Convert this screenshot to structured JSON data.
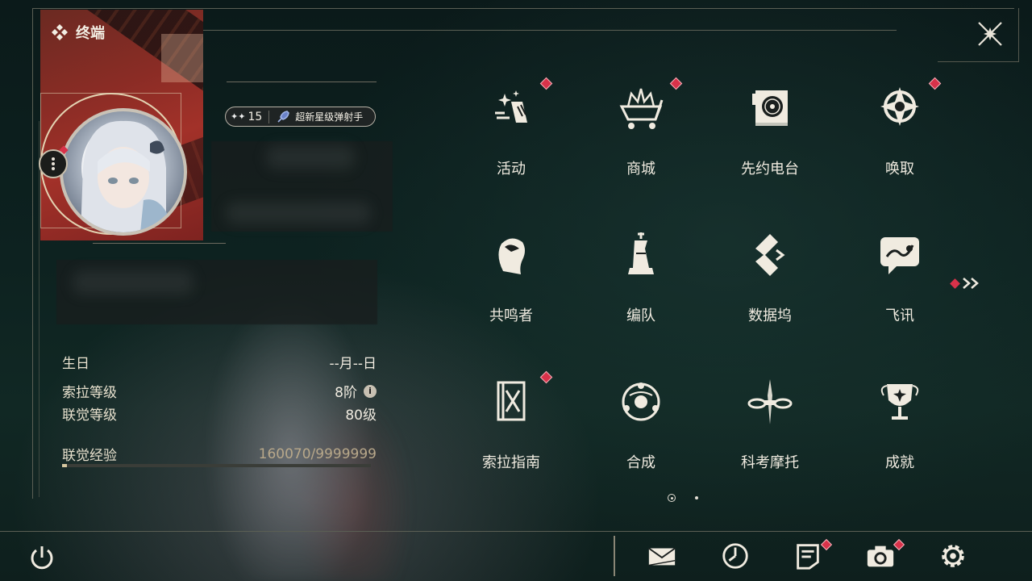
{
  "title": "终端",
  "profile": {
    "union_level_badge": "15",
    "title_badge": "超新星级弹射手",
    "has_notification": true
  },
  "info": {
    "birthday_label": "生日",
    "birthday_value": "--月--日",
    "sola_level_label": "索拉等级",
    "sola_level_value": "8阶",
    "union_level_label": "联觉等级",
    "union_level_value": "80级",
    "exp_label": "联觉经验",
    "exp_value": "160070/9999999",
    "exp_progress": 0.016
  },
  "menu": [
    {
      "label": "活动",
      "icon": "event-icon",
      "badge": true
    },
    {
      "label": "商城",
      "icon": "shop-crown-cart-icon",
      "badge": true
    },
    {
      "label": "先约电台",
      "icon": "radio-icon",
      "badge": false
    },
    {
      "label": "唤取",
      "icon": "convene-compass-icon",
      "badge": true
    },
    {
      "label": "共鸣者",
      "icon": "resonator-head-icon",
      "badge": false
    },
    {
      "label": "编队",
      "icon": "team-chess-icon",
      "badge": false
    },
    {
      "label": "数据坞",
      "icon": "data-bank-icon",
      "badge": false
    },
    {
      "label": "飞讯",
      "icon": "message-chat-icon",
      "badge": false
    },
    {
      "label": "索拉指南",
      "icon": "guide-book-icon",
      "badge": true
    },
    {
      "label": "合成",
      "icon": "synthesis-icon",
      "badge": false
    },
    {
      "label": "科考摩托",
      "icon": "motorbike-icon",
      "badge": false
    },
    {
      "label": "成就",
      "icon": "achievement-trophy-icon",
      "badge": false
    }
  ],
  "pager": {
    "current": 1,
    "total": 2
  },
  "bottom_bar": {
    "mail_badge": false,
    "clock_badge": false,
    "notes_badge": true,
    "camera_badge": true,
    "settings_badge": false
  },
  "colors": {
    "accent_red": "#d8324a",
    "text_light": "#f0ebe0",
    "line": "#5b5f54",
    "exp_text": "#b8a88a"
  }
}
